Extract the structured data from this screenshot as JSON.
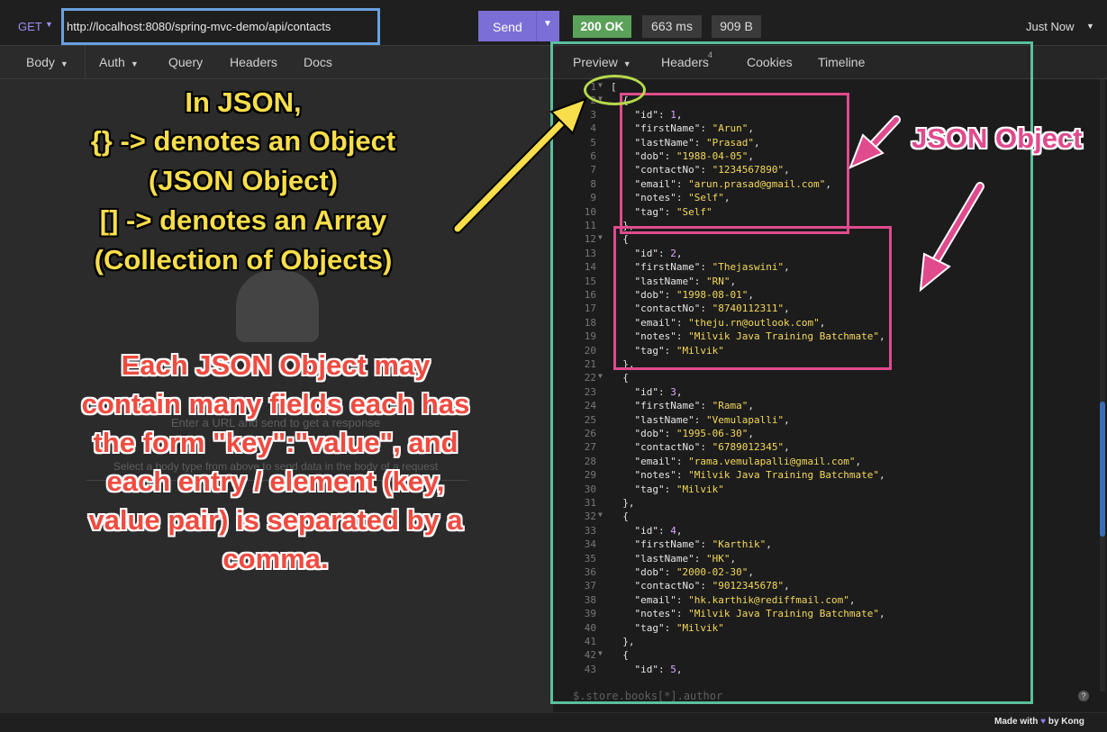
{
  "request": {
    "method": "GET",
    "url": "http://localhost:8080/spring-mvc-demo/api/contacts",
    "send_label": "Send"
  },
  "response": {
    "status": "200 OK",
    "time": "663 ms",
    "size": "909 B",
    "timestamp": "Just Now"
  },
  "left_tabs": [
    "Body",
    "Auth",
    "Query",
    "Headers",
    "Docs"
  ],
  "right_tabs": {
    "preview": "Preview",
    "headers": "Headers",
    "headers_count": "4",
    "cookies": "Cookies",
    "timeline": "Timeline"
  },
  "empty_state": {
    "title": "Enter a URL and send to get a response",
    "subtitle": "Select a body type from above to send data in the body of a request"
  },
  "code_lines": [
    {
      "n": "1",
      "fold": true,
      "parts": [
        [
          "k",
          "["
        ]
      ]
    },
    {
      "n": "2",
      "fold": true,
      "parts": [
        [
          "k",
          "  {"
        ]
      ]
    },
    {
      "n": "3",
      "fold": false,
      "parts": [
        [
          "k",
          "    \"id\": "
        ],
        [
          "n",
          "1"
        ],
        [
          "k",
          ","
        ]
      ]
    },
    {
      "n": "4",
      "fold": false,
      "parts": [
        [
          "k",
          "    \"firstName\": "
        ],
        [
          "s",
          "\"Arun\""
        ],
        [
          "k",
          ","
        ]
      ]
    },
    {
      "n": "5",
      "fold": false,
      "parts": [
        [
          "k",
          "    \"lastName\": "
        ],
        [
          "s",
          "\"Prasad\""
        ],
        [
          "k",
          ","
        ]
      ]
    },
    {
      "n": "6",
      "fold": false,
      "parts": [
        [
          "k",
          "    \"dob\": "
        ],
        [
          "s",
          "\"1988-04-05\""
        ],
        [
          "k",
          ","
        ]
      ]
    },
    {
      "n": "7",
      "fold": false,
      "parts": [
        [
          "k",
          "    \"contactNo\": "
        ],
        [
          "s",
          "\"1234567890\""
        ],
        [
          "k",
          ","
        ]
      ]
    },
    {
      "n": "8",
      "fold": false,
      "parts": [
        [
          "k",
          "    \"email\": "
        ],
        [
          "s",
          "\"arun.prasad@gmail.com\""
        ],
        [
          "k",
          ","
        ]
      ]
    },
    {
      "n": "9",
      "fold": false,
      "parts": [
        [
          "k",
          "    \"notes\": "
        ],
        [
          "s",
          "\"Self\""
        ],
        [
          "k",
          ","
        ]
      ]
    },
    {
      "n": "10",
      "fold": false,
      "parts": [
        [
          "k",
          "    \"tag\": "
        ],
        [
          "s",
          "\"Self\""
        ]
      ]
    },
    {
      "n": "11",
      "fold": false,
      "parts": [
        [
          "k",
          "  },"
        ]
      ]
    },
    {
      "n": "12",
      "fold": true,
      "parts": [
        [
          "k",
          "  {"
        ]
      ]
    },
    {
      "n": "13",
      "fold": false,
      "parts": [
        [
          "k",
          "    \"id\": "
        ],
        [
          "n",
          "2"
        ],
        [
          "k",
          ","
        ]
      ]
    },
    {
      "n": "14",
      "fold": false,
      "parts": [
        [
          "k",
          "    \"firstName\": "
        ],
        [
          "s",
          "\"Thejaswini\""
        ],
        [
          "k",
          ","
        ]
      ]
    },
    {
      "n": "15",
      "fold": false,
      "parts": [
        [
          "k",
          "    \"lastName\": "
        ],
        [
          "s",
          "\"RN\""
        ],
        [
          "k",
          ","
        ]
      ]
    },
    {
      "n": "16",
      "fold": false,
      "parts": [
        [
          "k",
          "    \"dob\": "
        ],
        [
          "s",
          "\"1998-08-01\""
        ],
        [
          "k",
          ","
        ]
      ]
    },
    {
      "n": "17",
      "fold": false,
      "parts": [
        [
          "k",
          "    \"contactNo\": "
        ],
        [
          "s",
          "\"8740112311\""
        ],
        [
          "k",
          ","
        ]
      ]
    },
    {
      "n": "18",
      "fold": false,
      "parts": [
        [
          "k",
          "    \"email\": "
        ],
        [
          "s",
          "\"theju.rn@outlook.com\""
        ],
        [
          "k",
          ","
        ]
      ]
    },
    {
      "n": "19",
      "fold": false,
      "parts": [
        [
          "k",
          "    \"notes\": "
        ],
        [
          "s",
          "\"Milvik Java Training Batchmate\""
        ],
        [
          "k",
          ","
        ]
      ]
    },
    {
      "n": "20",
      "fold": false,
      "parts": [
        [
          "k",
          "    \"tag\": "
        ],
        [
          "s",
          "\"Milvik\""
        ]
      ]
    },
    {
      "n": "21",
      "fold": false,
      "parts": [
        [
          "k",
          "  },"
        ]
      ]
    },
    {
      "n": "22",
      "fold": true,
      "parts": [
        [
          "k",
          "  {"
        ]
      ]
    },
    {
      "n": "23",
      "fold": false,
      "parts": [
        [
          "k",
          "    \"id\": "
        ],
        [
          "n",
          "3"
        ],
        [
          "k",
          ","
        ]
      ]
    },
    {
      "n": "24",
      "fold": false,
      "parts": [
        [
          "k",
          "    \"firstName\": "
        ],
        [
          "s",
          "\"Rama\""
        ],
        [
          "k",
          ","
        ]
      ]
    },
    {
      "n": "25",
      "fold": false,
      "parts": [
        [
          "k",
          "    \"lastName\": "
        ],
        [
          "s",
          "\"Vemulapalli\""
        ],
        [
          "k",
          ","
        ]
      ]
    },
    {
      "n": "26",
      "fold": false,
      "parts": [
        [
          "k",
          "    \"dob\": "
        ],
        [
          "s",
          "\"1995-06-30\""
        ],
        [
          "k",
          ","
        ]
      ]
    },
    {
      "n": "27",
      "fold": false,
      "parts": [
        [
          "k",
          "    \"contactNo\": "
        ],
        [
          "s",
          "\"6789012345\""
        ],
        [
          "k",
          ","
        ]
      ]
    },
    {
      "n": "28",
      "fold": false,
      "parts": [
        [
          "k",
          "    \"email\": "
        ],
        [
          "s",
          "\"rama.vemulapalli@gmail.com\""
        ],
        [
          "k",
          ","
        ]
      ]
    },
    {
      "n": "29",
      "fold": false,
      "parts": [
        [
          "k",
          "    \"notes\": "
        ],
        [
          "s",
          "\"Milvik Java Training Batchmate\""
        ],
        [
          "k",
          ","
        ]
      ]
    },
    {
      "n": "30",
      "fold": false,
      "parts": [
        [
          "k",
          "    \"tag\": "
        ],
        [
          "s",
          "\"Milvik\""
        ]
      ]
    },
    {
      "n": "31",
      "fold": false,
      "parts": [
        [
          "k",
          "  },"
        ]
      ]
    },
    {
      "n": "32",
      "fold": true,
      "parts": [
        [
          "k",
          "  {"
        ]
      ]
    },
    {
      "n": "33",
      "fold": false,
      "parts": [
        [
          "k",
          "    \"id\": "
        ],
        [
          "n",
          "4"
        ],
        [
          "k",
          ","
        ]
      ]
    },
    {
      "n": "34",
      "fold": false,
      "parts": [
        [
          "k",
          "    \"firstName\": "
        ],
        [
          "s",
          "\"Karthik\""
        ],
        [
          "k",
          ","
        ]
      ]
    },
    {
      "n": "35",
      "fold": false,
      "parts": [
        [
          "k",
          "    \"lastName\": "
        ],
        [
          "s",
          "\"HK\""
        ],
        [
          "k",
          ","
        ]
      ]
    },
    {
      "n": "36",
      "fold": false,
      "parts": [
        [
          "k",
          "    \"dob\": "
        ],
        [
          "s",
          "\"2000-02-30\""
        ],
        [
          "k",
          ","
        ]
      ]
    },
    {
      "n": "37",
      "fold": false,
      "parts": [
        [
          "k",
          "    \"contactNo\": "
        ],
        [
          "s",
          "\"9012345678\""
        ],
        [
          "k",
          ","
        ]
      ]
    },
    {
      "n": "38",
      "fold": false,
      "parts": [
        [
          "k",
          "    \"email\": "
        ],
        [
          "s",
          "\"hk.karthik@rediffmail.com\""
        ],
        [
          "k",
          ","
        ]
      ]
    },
    {
      "n": "39",
      "fold": false,
      "parts": [
        [
          "k",
          "    \"notes\": "
        ],
        [
          "s",
          "\"Milvik Java Training Batchmate\""
        ],
        [
          "k",
          ","
        ]
      ]
    },
    {
      "n": "40",
      "fold": false,
      "parts": [
        [
          "k",
          "    \"tag\": "
        ],
        [
          "s",
          "\"Milvik\""
        ]
      ]
    },
    {
      "n": "41",
      "fold": false,
      "parts": [
        [
          "k",
          "  },"
        ]
      ]
    },
    {
      "n": "42",
      "fold": true,
      "parts": [
        [
          "k",
          "  {"
        ]
      ]
    },
    {
      "n": "43",
      "fold": false,
      "parts": [
        [
          "k",
          "    \"id\": "
        ],
        [
          "n",
          "5"
        ],
        [
          "k",
          ","
        ]
      ]
    }
  ],
  "filter_placeholder": "$.store.books[*].author",
  "footer": {
    "made_with": "Made with",
    "by": "by Kong"
  },
  "annotations": {
    "yellow": [
      "In JSON,",
      "{} -> denotes an Object",
      "(JSON Object)",
      "[] -> denotes an Array",
      "(Collection of Objects)"
    ],
    "pink": "JSON Object",
    "red": [
      "Each JSON Object may",
      "contain many fields each has",
      "the form \"key\":\"value\", and",
      "each entry / element (key,",
      "value pair) is separated by a",
      "comma."
    ]
  },
  "colors": {
    "accent": "#7b6fd6",
    "status_ok": "#5aa15a",
    "string": "#f3d85c",
    "number": "#d9a7ff",
    "annotation_yellow": "#f7de4a",
    "annotation_red": "#ef4b40",
    "annotation_pink": "#e04b8d",
    "box_blue": "#6aa0e0",
    "box_teal": "#5bbf9b",
    "ellipse_green": "#b7d84c"
  },
  "icons": [
    "dropdown-caret-icon",
    "help-icon",
    "heart-icon",
    "bug-icon",
    "fold-arrow-icon"
  ]
}
